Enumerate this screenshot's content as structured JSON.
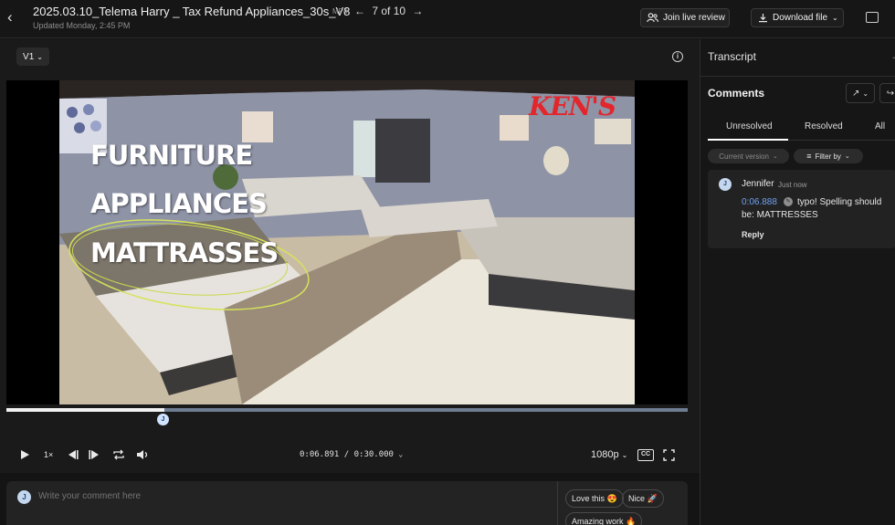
{
  "header": {
    "back_icon": "chevron-left-icon",
    "title": "2025.03.10_Telema Harry _ Tax Refund Appliances_30s_V8",
    "format_badge": "MP4",
    "pager_text": "7 of 10",
    "updated": "Updated Monday, 2:45 PM",
    "join_live_review_label": "Join live review",
    "download_label": "Download file"
  },
  "player": {
    "version_label": "V1",
    "overlay_lines": [
      "FURNITURE",
      "APPLIANCES",
      "MATTRASSES"
    ],
    "store_logo": "KEN'S",
    "progress": 0.232,
    "marker_initial": "J",
    "speed_label": "1×",
    "time_current": "0:06.891",
    "time_total": "0:30.000",
    "quality_label": "1080p",
    "cc_label": "CC"
  },
  "comment_input": {
    "avatar_initial": "J",
    "placeholder": "Write your comment here",
    "quick_reactions": [
      "Love this 😍",
      "Nice 🚀",
      "Amazing work 🔥"
    ]
  },
  "sidebar": {
    "transcript_title": "Transcript",
    "comments_title": "Comments",
    "tabs": [
      "Unresolved",
      "Resolved",
      "All"
    ],
    "active_tab": "Unresolved",
    "current_version_label": "Current version",
    "filter_label": "Filter by",
    "comments": [
      {
        "avatar_initial": "J",
        "author": "Jennifer",
        "time": "Just now",
        "timestamp": "0:06.888",
        "text_line1": "typo! Spelling should",
        "text_line2": "be: MATTRESSES",
        "reply_label": "Reply"
      }
    ]
  },
  "colors": {
    "background": "#141414",
    "panel": "#222222",
    "accent_link": "#6fa2f2",
    "progress_track": "#6f7d92",
    "logo_red": "#e3262b"
  }
}
